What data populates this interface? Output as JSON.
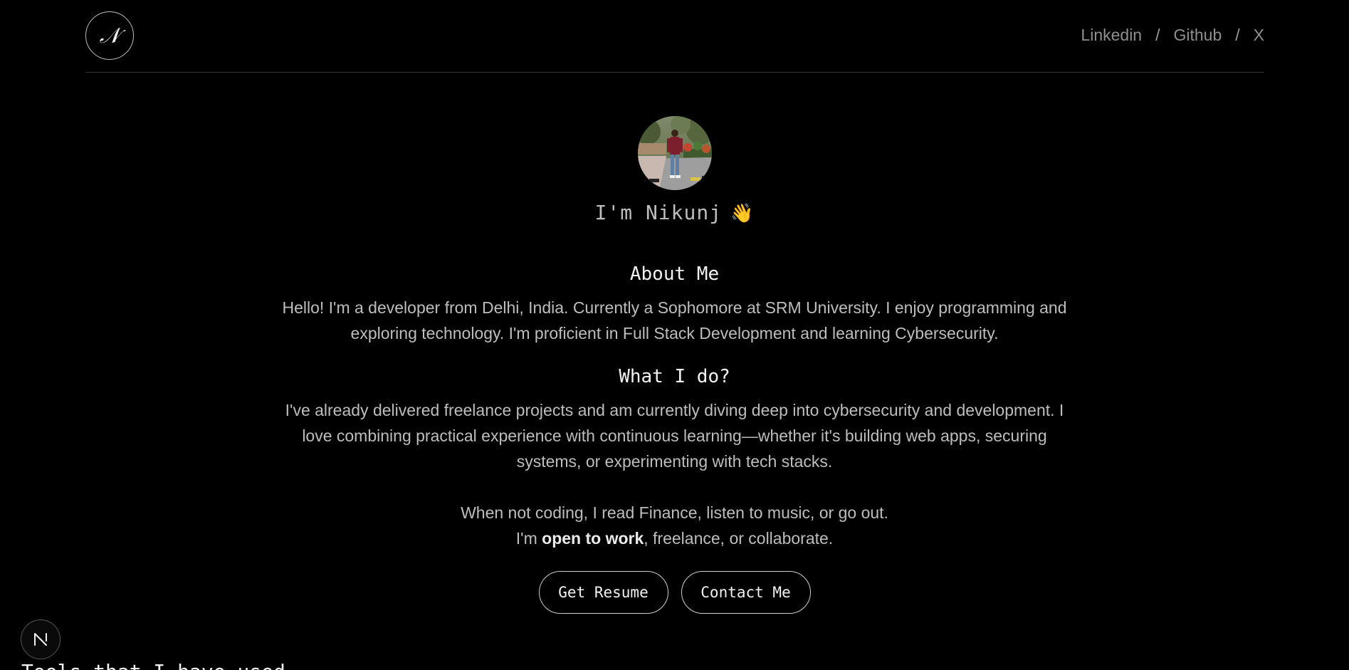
{
  "header": {
    "logo_glyph": "𝒩",
    "nav": [
      {
        "label": "Linkedin"
      },
      {
        "label": "Github"
      },
      {
        "label": "X"
      }
    ],
    "separator": "/"
  },
  "hero": {
    "greeting": "I'm Nikunj",
    "wave_emoji": "👋"
  },
  "about": {
    "title": "About Me",
    "text": "Hello! I'm a developer from Delhi, India. Currently a Sophomore at SRM University. I enjoy programming and exploring technology. I'm proficient in Full Stack Development and learning Cybersecurity."
  },
  "what": {
    "title": "What I do?",
    "text": "I've already delivered freelance projects and am currently diving deep into cybersecurity and development. I love combining practical experience with continuous learning—whether it's building web apps, securing systems, or experimenting with tech stacks.",
    "hobbies": "When not coding, I read Finance, listen to music, or go out.",
    "open_prefix": "I'm",
    "open_bold": "open to work",
    "open_suffix": ", freelance, or collaborate."
  },
  "buttons": {
    "resume": "Get Resume",
    "contact": "Contact Me"
  },
  "badge": {
    "letter": "N"
  },
  "tools": {
    "heading": "Tools that I have used"
  }
}
